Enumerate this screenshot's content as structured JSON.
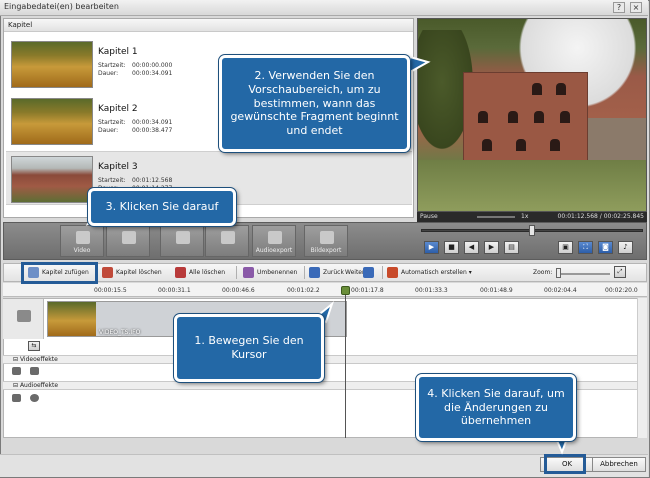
{
  "window": {
    "title": "Eingabedatei(en) bearbeiten"
  },
  "chapters": {
    "header": "Kapitel",
    "items": [
      {
        "name": "Kapitel 1",
        "start_label": "Startzeit:",
        "start": "00:00:00.000",
        "duration_label": "Dauer:",
        "duration": "00:00:34.091"
      },
      {
        "name": "Kapitel 2",
        "start_label": "Startzeit:",
        "start": "00:00:34.091",
        "duration_label": "Dauer:",
        "duration": "00:00:38.477"
      },
      {
        "name": "Kapitel 3",
        "start_label": "Startzeit:",
        "start": "00:01:12.568",
        "duration_label": "Dauer:",
        "duration": "00:01:14.277"
      }
    ]
  },
  "preview": {
    "status": "Pause",
    "rate": "1x",
    "time": "00:01:12.568 / 00:02:25.845",
    "seek_fraction": 0.5
  },
  "band_buttons": {
    "video": "Video",
    "audioexport": "Audioexport",
    "bildexport": "Bildexport"
  },
  "toolbar": {
    "add_chapter": "Kapitel zufügen",
    "delete_chapter": "Kapitel löschen",
    "delete_all": "Alle löschen",
    "rename": "Umbenennen",
    "back": "Zurück",
    "next": "Weiter",
    "auto_create": "Automatisch erstellen",
    "zoom": "Zoom:"
  },
  "ruler": [
    "00:00:15.5",
    "00:00:31.1",
    "00:00:46.6",
    "00:01:02.2",
    "00:01:17.8",
    "00:01:33.3",
    "00:01:48.9",
    "00:02:04.4",
    "00:02:20.0"
  ],
  "tracks": {
    "clip_label": "VIDEO_TS.IFO",
    "video_effects": "Videoeffekte",
    "audio_effects": "Audioeffekte"
  },
  "dialog": {
    "ok": "OK",
    "cancel": "Abbrechen"
  },
  "callouts": {
    "one": "1. Bewegen Sie den Kursor",
    "two": "2. Verwenden Sie den Vorschaubereich, um zu bestimmen, wann das gewünschte Fragment beginnt und  endet",
    "three": "3. Klicken Sie darauf",
    "four": "4. Klicken Sie darauf, um die Änderungen zu übernehmen"
  },
  "colors": {
    "callout": "#2368a6",
    "highlight": "#245b97"
  }
}
